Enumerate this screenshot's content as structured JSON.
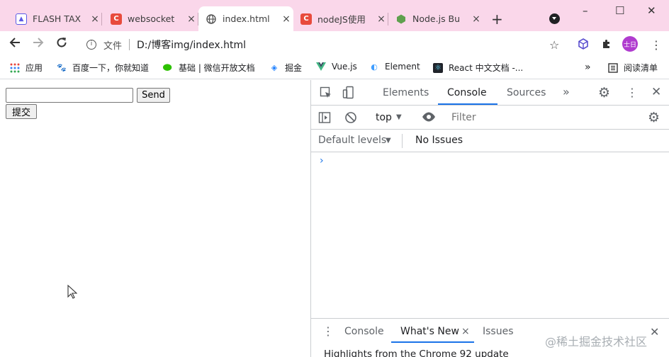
{
  "tabs": [
    {
      "title": "FLASH TAX",
      "favicon": "flash-tax-favicon",
      "close": "×"
    },
    {
      "title": "websocket",
      "favicon": "csdn-favicon",
      "close": "×"
    },
    {
      "title": "index.html",
      "favicon": "globe-icon",
      "close": "×"
    },
    {
      "title": "nodeJS使用",
      "favicon": "csdn-favicon",
      "close": "×"
    },
    {
      "title": "Node.js Bu",
      "favicon": "nodejs-favicon",
      "close": "×"
    }
  ],
  "window": {
    "new_tab": "+",
    "minimize": "–",
    "maximize": "☐",
    "close": "✕"
  },
  "toolbar": {
    "url_scheme": "文件",
    "url": "D:/博客img/index.html",
    "avatar_text": "士日"
  },
  "bookmarks": [
    {
      "label": "应用",
      "icon": "apps-grid-icon"
    },
    {
      "label": "百度一下，你就知道",
      "icon": "baidu-paw-icon"
    },
    {
      "label": "基础 | 微信开放文档",
      "icon": "wechat-icon"
    },
    {
      "label": "掘金",
      "icon": "juejin-icon"
    },
    {
      "label": "Vue.js",
      "icon": "vue-icon"
    },
    {
      "label": "Element",
      "icon": "element-icon"
    },
    {
      "label": "React 中文文档 -...",
      "icon": "react-icon"
    }
  ],
  "bookmarks_more": "»",
  "reading_list": "阅读清单",
  "page": {
    "input_value": "",
    "send_label": "Send",
    "submit_label": "提交"
  },
  "devtools": {
    "tabs": [
      "Elements",
      "Console",
      "Sources"
    ],
    "active_tab": "Console",
    "more": "»",
    "context": "top",
    "filter_placeholder": "Filter",
    "levels": "Default levels",
    "issues": "No Issues",
    "prompt": "›",
    "drawer_tabs": [
      "Console",
      "What's New",
      "Issues"
    ],
    "drawer_active": "What's New",
    "drawer_close": "×",
    "highlight_text": "Highlights from the Chrome 92 update",
    "watermark": "@稀土掘金技术社区"
  },
  "colors": {
    "tabstrip": "#fad7ea",
    "accent": "#1a73e8",
    "avatar": "#b03ccf"
  }
}
